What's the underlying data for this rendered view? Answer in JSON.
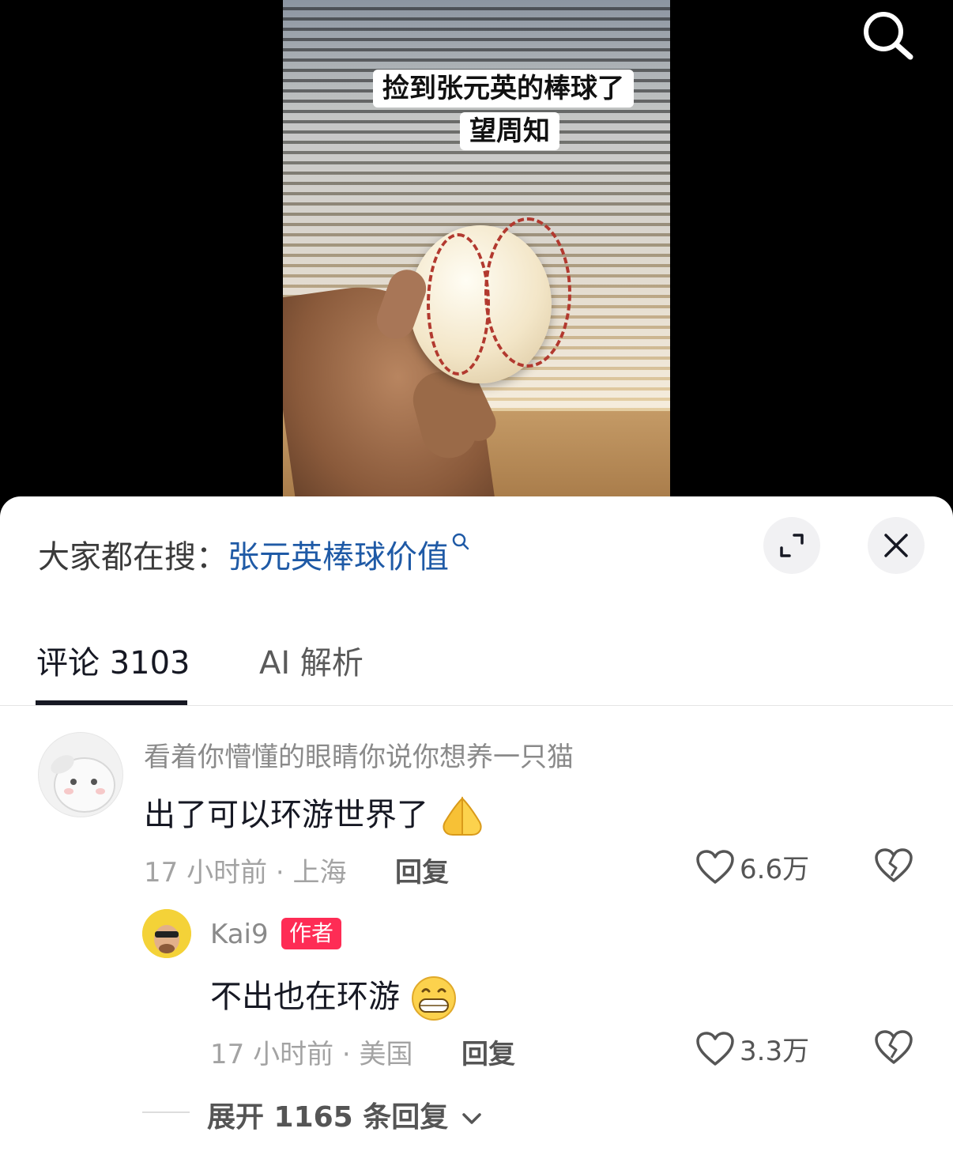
{
  "video": {
    "caption_line1": "捡到张元英的棒球了",
    "caption_line2": "望周知"
  },
  "top_bar": {
    "search_icon": "search-icon"
  },
  "sheet": {
    "hot_search_prefix": "大家都在搜：",
    "hot_search_term": "张元英棒球价值",
    "expand_icon": "expand-icon",
    "close_icon": "close-icon",
    "tabs": [
      {
        "label": "评论 3103",
        "active": true
      },
      {
        "label": "AI 解析",
        "active": false
      }
    ]
  },
  "comments": [
    {
      "username": "看着你懵懂的眼睛你说你想养一只猫",
      "text": "出了可以环游世界了",
      "emoji": "praying-hands-emoji",
      "time": "17 小时前",
      "location": "上海",
      "meta": "17 小时前 · 上海",
      "reply_label": "回复",
      "likes": "6.6万"
    }
  ],
  "reply": {
    "username": "Kai9",
    "badge": "作者",
    "text": "不出也在环游",
    "emoji": "grinning-emoji",
    "meta": "17 小时前 · 美国",
    "reply_label": "回复",
    "likes": "3.3万"
  },
  "expand_replies": "展开 1165 条回复"
}
